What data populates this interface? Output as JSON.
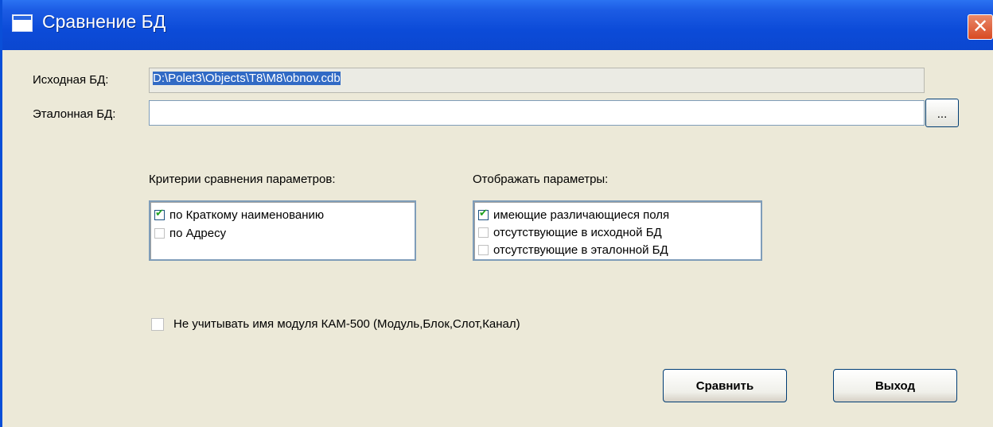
{
  "window": {
    "title": "Сравнение БД",
    "close_glyph": "✕"
  },
  "source_db": {
    "label": "Исходная БД:",
    "value": "D:\\Polet3\\Objects\\T8\\M8\\obnov.cdb"
  },
  "reference_db": {
    "label": "Эталонная БД:",
    "value": "",
    "browse_label": "..."
  },
  "criteria": {
    "label": "Критерии сравнения параметров:",
    "items": [
      {
        "label": "по Краткому наименованию",
        "checked": true
      },
      {
        "label": "по Адресу",
        "checked": false
      }
    ]
  },
  "display": {
    "label": "Отображать параметры:",
    "items": [
      {
        "label": "имеющие различающиеся поля",
        "checked": true
      },
      {
        "label": "отсутствующие в исходной БД",
        "checked": false
      },
      {
        "label": "отсутствующие в эталонной БД",
        "checked": false
      }
    ]
  },
  "ignore_module": {
    "label": "Не учитывать имя модуля КАМ-500 (Модуль,Блок,Слот,Канал)",
    "checked": false
  },
  "buttons": {
    "compare": "Сравнить",
    "exit": "Выход"
  },
  "colors": {
    "title_bar": "#0b47d0",
    "window_bg": "#ece9d8",
    "selection": "#316ac5",
    "check": "#21a121"
  }
}
